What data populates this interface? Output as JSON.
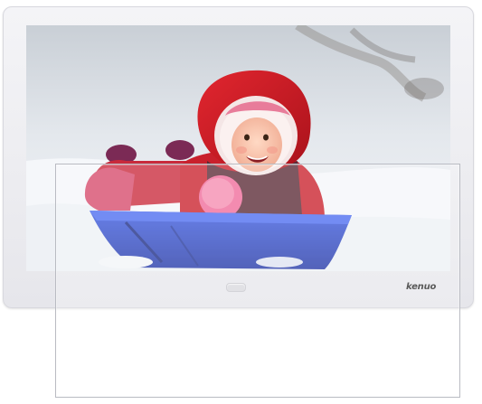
{
  "product": {
    "brand": "kenuo"
  },
  "screen": {
    "photo": "child-on-sled-in-snow-image"
  },
  "colors": {
    "frame": "#ececf0",
    "sled": "#2f49c9",
    "hood": "#d41f2a",
    "snow": "#f3f5f8"
  }
}
